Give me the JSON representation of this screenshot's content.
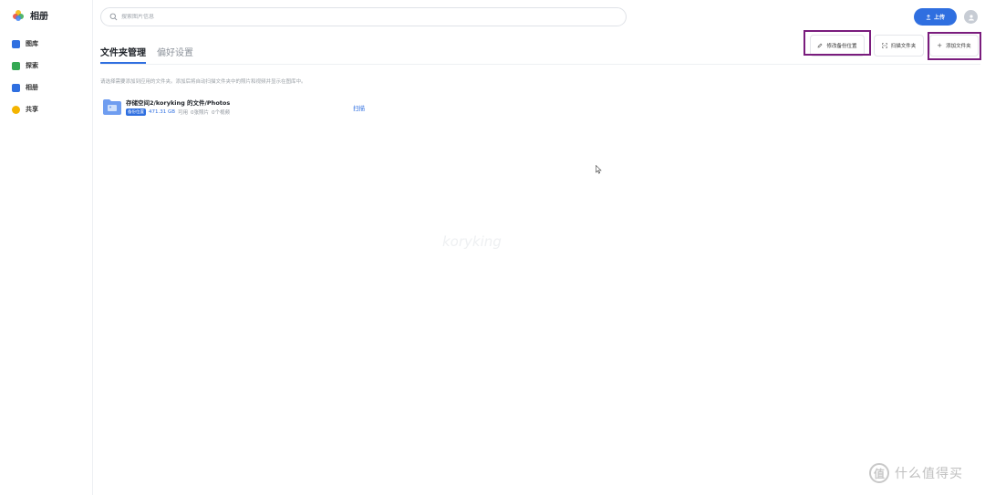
{
  "app": {
    "title": "相册"
  },
  "sidebar": {
    "items": [
      {
        "label": "图库",
        "icon": "gallery-icon",
        "color": "#2f6fe0"
      },
      {
        "label": "探索",
        "icon": "explore-icon",
        "color": "#34a853"
      },
      {
        "label": "相册",
        "icon": "album-icon",
        "color": "#2f6fe0"
      },
      {
        "label": "共享",
        "icon": "share-icon",
        "color": "#f4b400"
      }
    ]
  },
  "search": {
    "placeholder": "搜索图片信息",
    "value": ""
  },
  "header": {
    "upload_label": "上传"
  },
  "tabs": [
    {
      "label": "文件夹管理",
      "active": true
    },
    {
      "label": "偏好设置",
      "active": false
    }
  ],
  "actions": {
    "edit_backup": "修改备份位置",
    "scan_folder": "扫描文件夹",
    "add_folder": "添加文件夹"
  },
  "hint": "请选择需要添加到应用的文件夹。添加后将自动扫描文件夹中的照片和视频并显示在图库中。",
  "folders": [
    {
      "path": "存储空间2/koryking 的文件/Photos",
      "badge": "备份位置",
      "size": "471.31 GB",
      "available": "可用",
      "photos": "0张照片",
      "videos": "0个视频",
      "scan": "扫描"
    }
  ],
  "watermark": "koryking",
  "corner": {
    "text": "什么值得买",
    "logo": "值"
  },
  "colors": {
    "accent": "#2f6fe0",
    "highlight": "#7a1c7d"
  }
}
